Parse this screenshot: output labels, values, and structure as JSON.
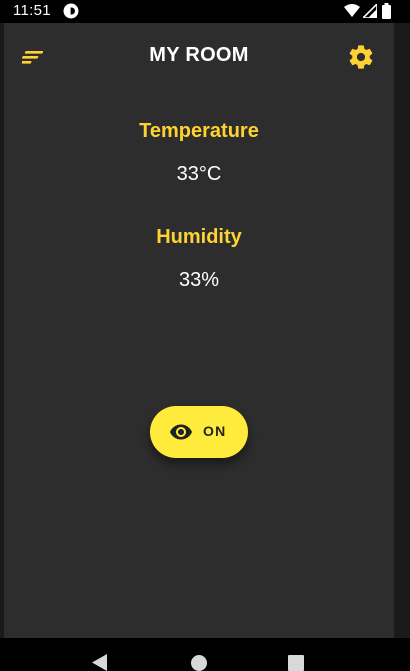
{
  "status_bar": {
    "time": "11:51",
    "app_icon": "app-notification-icon",
    "icons": [
      "wifi-icon",
      "cellular-icon",
      "battery-icon"
    ]
  },
  "app_bar": {
    "title": "MY ROOM",
    "menu_icon": "menu-icon",
    "settings_icon": "gear-icon"
  },
  "sensors": {
    "temperature": {
      "label": "Temperature",
      "value": "33°C"
    },
    "humidity": {
      "label": "Humidity",
      "value": "33%"
    }
  },
  "toggle": {
    "icon": "eye-icon",
    "label": "ON"
  },
  "nav_bar": {
    "buttons": [
      "back-icon",
      "home-icon",
      "recents-icon"
    ]
  },
  "colors": {
    "accent": "#ffd233",
    "button": "#ffeb3b",
    "background": "#2d2d2d"
  }
}
